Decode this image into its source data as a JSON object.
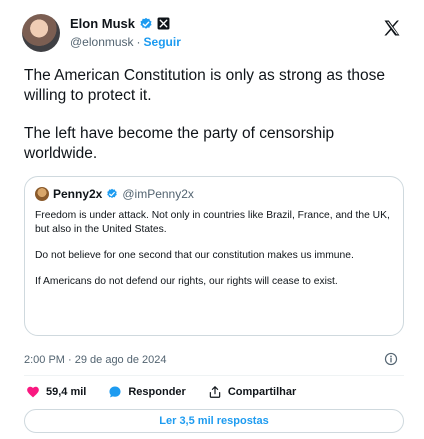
{
  "author": {
    "name": "Elon Musk",
    "handle": "@elonmusk",
    "separator": "·",
    "follow_label": "Seguir",
    "verified_icon": "verified-badge-icon",
    "affiliation_icon": "x-affiliation-icon"
  },
  "header": {
    "logo_icon": "x-logo-icon"
  },
  "tweet": {
    "paragraphs": [
      "The American Constitution is only as strong as those willing to protect it.",
      "The left have become the party of censorship worldwide."
    ],
    "timestamp": "2:00 PM · 29 de ago de 2024"
  },
  "quote": {
    "name": "Penny2x",
    "handle": "@imPenny2x",
    "paragraphs": [
      "Freedom is under attack. Not only in countries like Brazil, France, and the UK, but also in the United States.",
      "Do not believe for one second that our constitution makes us immune.",
      "If Americans do not defend our rights, our rights will cease to exist."
    ]
  },
  "actions": {
    "likes": "59,4 mil",
    "reply_label": "Responder",
    "share_label": "Compartilhar",
    "like_color": "#f91880",
    "reply_color": "#1d9bf0"
  },
  "footer": {
    "replies_button": "Ler 3,5 mil respostas"
  },
  "colors": {
    "accent": "#1d9bf0",
    "text": "#0f1419",
    "muted": "#536471",
    "border": "#cfd9de"
  }
}
